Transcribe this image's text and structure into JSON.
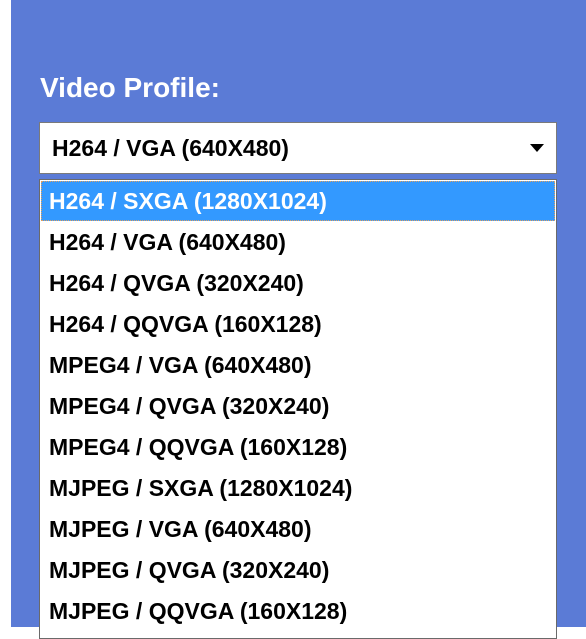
{
  "form": {
    "label": "Video Profile:",
    "selected_value": "H264 / VGA (640X480)",
    "highlighted_option": "H264 / SXGA (1280X1024)",
    "options": [
      "H264 / SXGA (1280X1024)",
      "H264 / VGA (640X480)",
      "H264 / QVGA (320X240)",
      "H264 / QQVGA (160X128)",
      "MPEG4 / VGA (640X480)",
      "MPEG4 / QVGA (320X240)",
      "MPEG4 / QQVGA (160X128)",
      "MJPEG / SXGA (1280X1024)",
      "MJPEG / VGA (640X480)",
      "MJPEG / QVGA (320X240)",
      "MJPEG / QQVGA (160X128)"
    ]
  },
  "colors": {
    "panel_background": "#5b7bd6",
    "highlight": "#3399ff",
    "label_text": "#ffffff"
  },
  "icons": {
    "dropdown_arrow": "chevron-down-icon"
  }
}
